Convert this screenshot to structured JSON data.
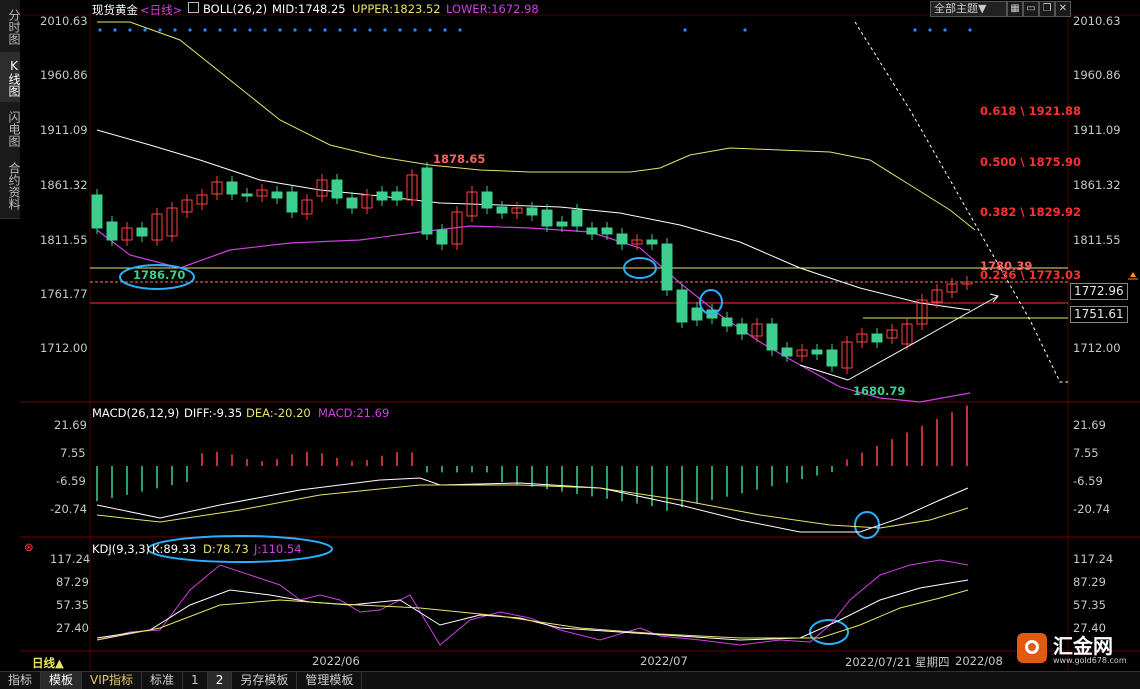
{
  "sidebar": {
    "tabs": [
      "分时图",
      "K线图",
      "闪电图",
      "合约资料"
    ],
    "active": 1
  },
  "header": {
    "title": "现货黄金",
    "period": "<日线>",
    "indicator": "BOLL(26,2)",
    "mid": "MID:1748.25",
    "upper": "UPPER:1823.52",
    "lower": "LOWER:1672.98",
    "theme": "全部主题▼"
  },
  "toolbar_icons": [
    "grid-icon",
    "window-icon",
    "restore-icon",
    "close-icon"
  ],
  "price_axis": [
    "2010.63",
    "1960.86",
    "1911.09",
    "1861.32",
    "1811.55",
    "1761.77",
    "1712.00"
  ],
  "price_boxes": {
    "current": "1772.96",
    "level": "1751.61"
  },
  "fib_levels": [
    "0.618 \\ 1921.88",
    "0.500 \\ 1875.90",
    "0.382 \\ 1829.92",
    "0.236 \\ 1773.03"
  ],
  "annotations": {
    "high": "1878.65",
    "low": "1680.79",
    "left": "1786.70",
    "recent": "1780.39"
  },
  "macd": {
    "title": "MACD(26,12,9)",
    "diff": "DIFF:-9.35",
    "dea": "DEA:-20.20",
    "macd": "MACD:21.69",
    "axis": [
      "21.69",
      "7.55",
      "-6.59",
      "-20.74"
    ]
  },
  "kdj": {
    "title": "KDJ(9,3,3)",
    "k": "K:89.33",
    "d": "D:78.73",
    "j": "J:110.54",
    "axis": [
      "117.24",
      "87.29",
      "57.35",
      "27.40"
    ]
  },
  "date_axis": {
    "labels": [
      "2022/06",
      "2022/07",
      "2022/07/21 星期四",
      "2022/08"
    ],
    "period_label": "日线▲"
  },
  "bottom_bar": [
    "指标",
    "模板",
    "VIP指标",
    "标准",
    "1",
    "2",
    "另存模板",
    "管理模板"
  ],
  "logo": {
    "name": "汇金网",
    "url": "www.gold678.com"
  },
  "colors": {
    "up": "#ff4040",
    "down": "#3ecf8e",
    "mid": "#ffffff",
    "upper": "#e8e36b",
    "lower": "#d040e0",
    "circle": "#2ab0ff"
  }
}
